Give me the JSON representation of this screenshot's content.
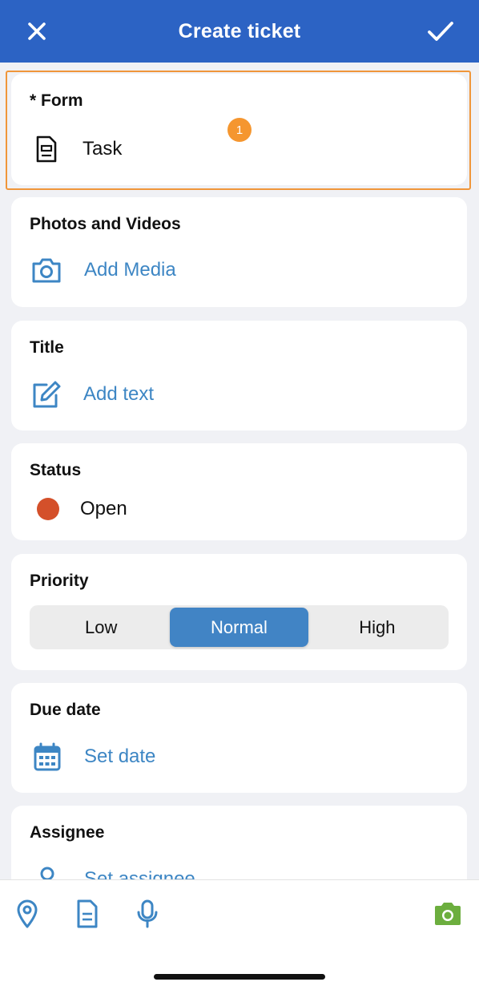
{
  "header": {
    "title": "Create ticket"
  },
  "form": {
    "label": "* Form",
    "value": "Task",
    "badge": "1"
  },
  "media": {
    "label": "Photos and Videos",
    "action": "Add Media"
  },
  "title_field": {
    "label": "Title",
    "action": "Add text"
  },
  "status": {
    "label": "Status",
    "value": "Open",
    "dot_color": "#d4502a"
  },
  "priority": {
    "label": "Priority",
    "options": [
      "Low",
      "Normal",
      "High"
    ],
    "selected": "Normal"
  },
  "due_date": {
    "label": "Due date",
    "action": "Set date"
  },
  "assignee": {
    "label": "Assignee",
    "action": "Set assignee"
  },
  "toolbar": {
    "icons": [
      "location-pin-icon",
      "document-icon",
      "microphone-icon",
      "camera-icon"
    ]
  },
  "colors": {
    "header": "#2c63c4",
    "accent": "#3d86c4",
    "highlight": "#f0963a",
    "camera": "#6cae3e"
  }
}
